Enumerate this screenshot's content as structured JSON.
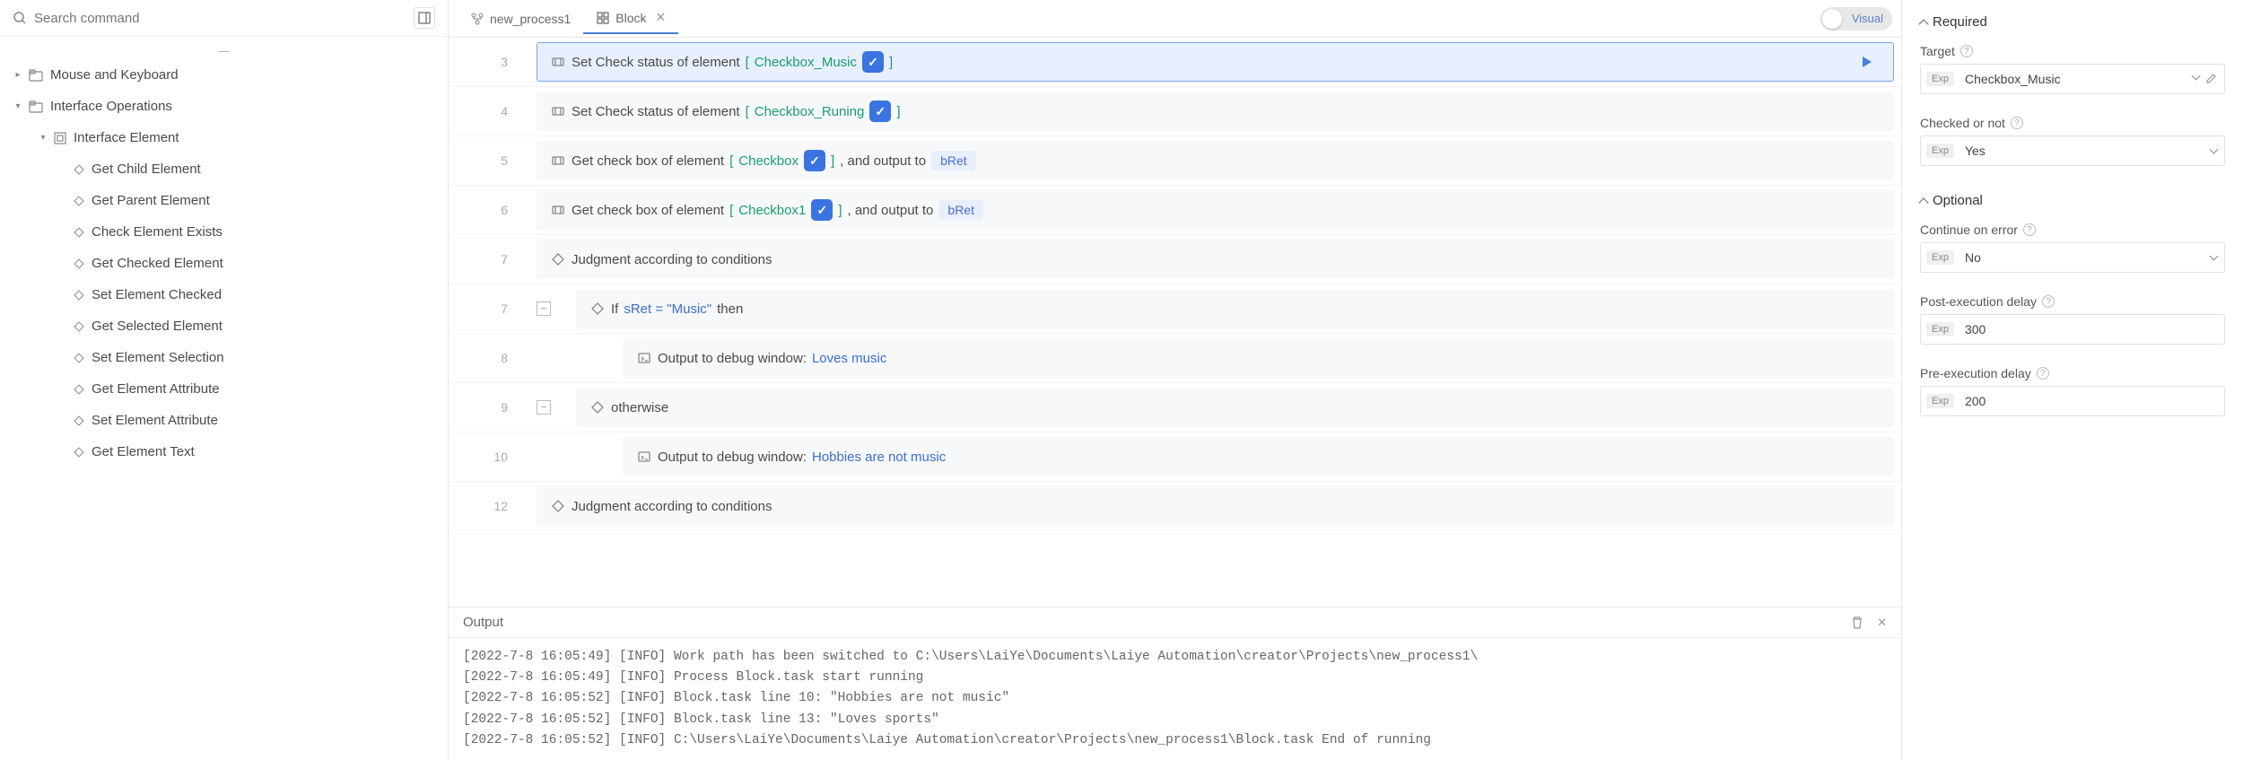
{
  "search": {
    "placeholder": "Search command"
  },
  "tree": {
    "mouse_keyboard": "Mouse and Keyboard",
    "interface_ops": "Interface Operations",
    "interface_element": "Interface Element",
    "items": [
      "Get Child Element",
      "Get Parent Element",
      "Check Element Exists",
      "Get Checked Element",
      "Set Element Checked",
      "Get Selected Element",
      "Set Element Selection",
      "Get Element Attribute",
      "Set Element Attribute",
      "Get Element Text"
    ]
  },
  "tabs": {
    "process": "new_process1",
    "block": "Block",
    "visual": "Visual"
  },
  "lines": [
    {
      "num": "3",
      "prefix": "Set Check status of element",
      "var": "Checkbox_Music"
    },
    {
      "num": "4",
      "prefix": "Set Check status of element",
      "var": "Checkbox_Runing"
    },
    {
      "num": "5",
      "prefix": "Get check box of element",
      "var": "Checkbox",
      "suffix": ", and output to",
      "out": "bRet"
    },
    {
      "num": "6",
      "prefix": "Get check box of element",
      "var": "Checkbox1",
      "suffix": ", and output to",
      "out": "bRet"
    },
    {
      "num": "7",
      "text": "Judgment according to conditions"
    },
    {
      "num": "7",
      "if_pre": "If ",
      "if_cond": "sRet = \"Music\"",
      "if_post": " then"
    },
    {
      "num": "8",
      "dbg_pre": "Output to debug window: ",
      "dbg_val": "Loves music"
    },
    {
      "num": "9",
      "text": "otherwise"
    },
    {
      "num": "10",
      "dbg_pre": "Output to debug window: ",
      "dbg_val": "Hobbies are not music"
    },
    {
      "num": "12",
      "text": "Judgment according to conditions"
    }
  ],
  "output": {
    "title": "Output",
    "lines": [
      "[2022-7-8 16:05:49] [INFO] Work path has been switched to C:\\Users\\LaiYe\\Documents\\Laiye Automation\\creator\\Projects\\new_process1\\",
      "[2022-7-8 16:05:49] [INFO] Process Block.task start running",
      "[2022-7-8 16:05:52] [INFO] Block.task line 10: \"Hobbies are not music\"",
      "[2022-7-8 16:05:52] [INFO] Block.task line 13: \"Loves sports\"",
      "[2022-7-8 16:05:52] [INFO] C:\\Users\\LaiYe\\Documents\\Laiye Automation\\creator\\Projects\\new_process1\\Block.task End of running"
    ]
  },
  "props": {
    "required": "Required",
    "optional": "Optional",
    "target": "Target",
    "target_val": "Checkbox_Music",
    "checked": "Checked or not",
    "checked_val": "Yes",
    "continue": "Continue on error",
    "continue_val": "No",
    "post_delay": "Post-execution delay",
    "post_delay_val": "300",
    "pre_delay": "Pre-execution delay",
    "pre_delay_val": "200"
  }
}
